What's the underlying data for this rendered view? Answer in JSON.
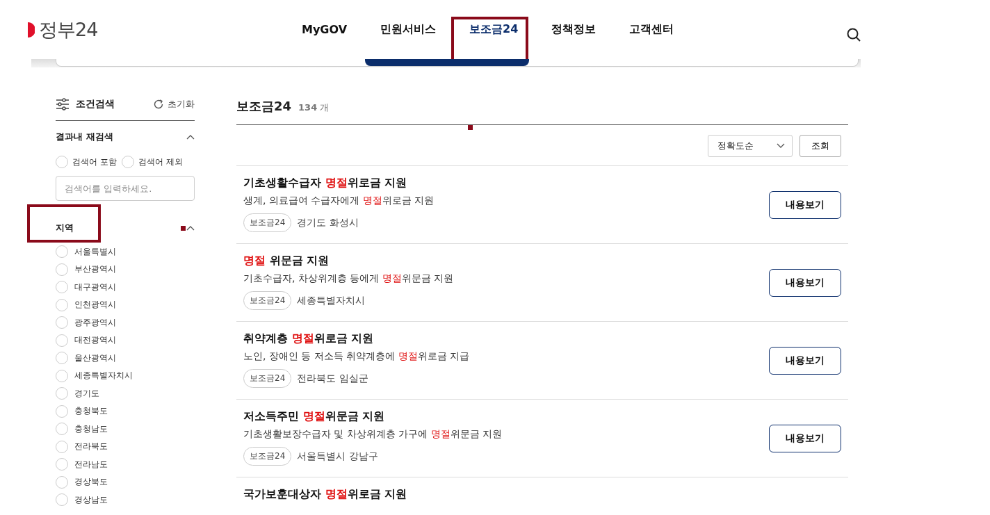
{
  "header": {
    "logo": "정부24",
    "nav": [
      {
        "label": "MyGOV",
        "selected": false,
        "annotated": false
      },
      {
        "label": "민원서비스",
        "selected": false,
        "annotated": false
      },
      {
        "label": "보조금24",
        "selected": true,
        "annotated": true
      },
      {
        "label": "정책정보",
        "selected": false,
        "annotated": false
      },
      {
        "label": "고객센터",
        "selected": false,
        "annotated": false
      }
    ]
  },
  "sidebar": {
    "title": "조건검색",
    "reset": "초기화",
    "refine": {
      "title": "결과내 재검색",
      "expanded": true,
      "options": [
        {
          "label": "검색어 포함",
          "selected": false
        },
        {
          "label": "검색어 제외",
          "selected": false
        }
      ],
      "placeholder": "검색어를 입력하세요."
    },
    "region": {
      "title": "지역",
      "expanded": true,
      "annotated": true,
      "marker": true,
      "options": [
        {
          "label": "서울특별시",
          "selected": false
        },
        {
          "label": "부산광역시",
          "selected": false
        },
        {
          "label": "대구광역시",
          "selected": false
        },
        {
          "label": "인천광역시",
          "selected": false
        },
        {
          "label": "광주광역시",
          "selected": false
        },
        {
          "label": "대전광역시",
          "selected": false
        },
        {
          "label": "울산광역시",
          "selected": false
        },
        {
          "label": "세종특별자치시",
          "selected": false
        },
        {
          "label": "경기도",
          "selected": false
        },
        {
          "label": "충청북도",
          "selected": false
        },
        {
          "label": "충청남도",
          "selected": false
        },
        {
          "label": "전라북도",
          "selected": false
        },
        {
          "label": "전라남도",
          "selected": false
        },
        {
          "label": "경상북도",
          "selected": false
        },
        {
          "label": "경상남도",
          "selected": false
        }
      ]
    }
  },
  "results": {
    "title": "보조금24",
    "count": "134",
    "count_unit": "개",
    "marker": true,
    "sort": "정확도순",
    "search_button": "조회",
    "items": [
      {
        "title": [
          {
            "text": "기초생활수급자 ",
            "hl": false
          },
          {
            "text": "명절",
            "hl": true
          },
          {
            "text": "위로금 지원",
            "hl": false
          }
        ],
        "desc": [
          {
            "text": "생계, 의료급여 수급자에게 ",
            "hl": false
          },
          {
            "text": "명절",
            "hl": true
          },
          {
            "text": "위로금 지원",
            "hl": false
          }
        ],
        "tag": "보조금24",
        "location": "경기도 화성시",
        "button": "내용보기"
      },
      {
        "title": [
          {
            "text": "명절",
            "hl": true
          },
          {
            "text": " 위문금 지원",
            "hl": false
          }
        ],
        "desc": [
          {
            "text": "기초수급자, 차상위계층 등에게 ",
            "hl": false
          },
          {
            "text": "명절",
            "hl": true
          },
          {
            "text": "위문금 지원",
            "hl": false
          }
        ],
        "tag": "보조금24",
        "location": "세종특별자치시",
        "button": "내용보기"
      },
      {
        "title": [
          {
            "text": "취약계층 ",
            "hl": false
          },
          {
            "text": "명절",
            "hl": true
          },
          {
            "text": "위로금 지원",
            "hl": false
          }
        ],
        "desc": [
          {
            "text": "노인, 장애인 등 저소득 취약계층에 ",
            "hl": false
          },
          {
            "text": "명절",
            "hl": true
          },
          {
            "text": "위로금 지급",
            "hl": false
          }
        ],
        "tag": "보조금24",
        "location": "전라북도 임실군",
        "button": "내용보기"
      },
      {
        "title": [
          {
            "text": "저소득주민 ",
            "hl": false
          },
          {
            "text": "명절",
            "hl": true
          },
          {
            "text": "위문금 지원",
            "hl": false
          }
        ],
        "desc": [
          {
            "text": "기초생활보장수급자 및 차상위계층 가구에 ",
            "hl": false
          },
          {
            "text": "명절",
            "hl": true
          },
          {
            "text": "위문금 지원",
            "hl": false
          }
        ],
        "tag": "보조금24",
        "location": "서울특별시 강남구",
        "button": "내용보기"
      },
      {
        "title": [
          {
            "text": "국가보훈대상자 ",
            "hl": false
          },
          {
            "text": "명절",
            "hl": true
          },
          {
            "text": "위로금 지원",
            "hl": false
          }
        ]
      }
    ]
  }
}
